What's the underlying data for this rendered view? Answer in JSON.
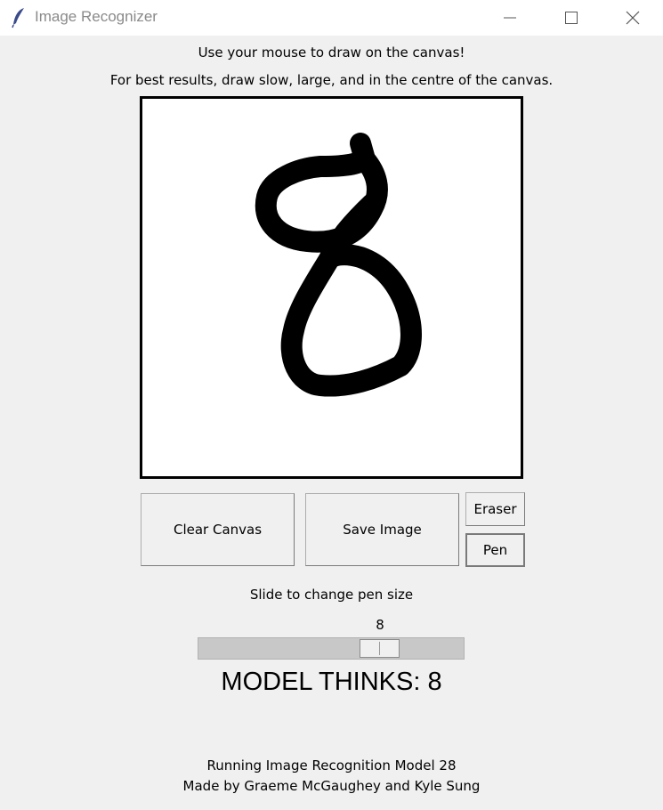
{
  "window": {
    "title": "Image Recognizer",
    "icon": "feather-icon",
    "controls": [
      "minimize-icon",
      "maximize-icon",
      "close-icon"
    ]
  },
  "instructions": {
    "line1": "Use your mouse to draw on the canvas!",
    "line2": "For best results, draw slow, large, and in the centre of the canvas."
  },
  "canvas": {
    "background": "#ffffff",
    "stroke_color": "#000000"
  },
  "buttons": {
    "clear": "Clear Canvas",
    "save": "Save Image",
    "eraser": "Eraser",
    "pen": "Pen"
  },
  "slider": {
    "label": "Slide to change pen size",
    "value": 8
  },
  "prediction": {
    "text": "MODEL THINKS: 8"
  },
  "footer": {
    "line1": "Running Image Recognition Model 28",
    "line2": "Made by Graeme McGaughey and Kyle Sung"
  }
}
